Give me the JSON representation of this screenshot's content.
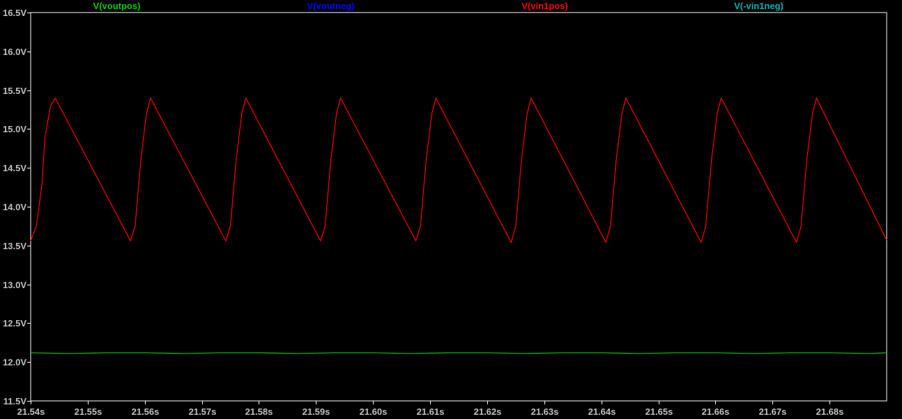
{
  "chart_data": {
    "type": "line",
    "background": "#000000",
    "axis_color": "#ffffff",
    "tick_label_color": "#c0c0c0",
    "grid": false,
    "xlim": [
      21.54,
      21.69
    ],
    "ylim": [
      11.5,
      16.5
    ],
    "x_ticks": [
      21.54,
      21.55,
      21.56,
      21.57,
      21.58,
      21.59,
      21.6,
      21.61,
      21.62,
      21.63,
      21.64,
      21.65,
      21.66,
      21.67,
      21.68
    ],
    "x_tick_labels": [
      "21.54s",
      "21.55s",
      "21.56s",
      "21.57s",
      "21.58s",
      "21.59s",
      "21.60s",
      "21.61s",
      "21.62s",
      "21.63s",
      "21.64s",
      "21.65s",
      "21.66s",
      "21.67s",
      "21.68s"
    ],
    "y_ticks": [
      11.5,
      12.0,
      12.5,
      13.0,
      13.5,
      14.0,
      14.5,
      15.0,
      15.5,
      16.0,
      16.5
    ],
    "y_tick_labels": [
      "11.5V",
      "12.0V",
      "12.5V",
      "13.0V",
      "13.5V",
      "14.0V",
      "14.5V",
      "15.0V",
      "15.5V",
      "16.0V",
      "16.5V"
    ],
    "legend_placement": "top",
    "series": [
      {
        "name": "V(voutpos)",
        "color": "#00cc00",
        "x": [
          21.54,
          21.5467,
          21.5533,
          21.56,
          21.5667,
          21.5733,
          21.58,
          21.5867,
          21.5933,
          21.6,
          21.6067,
          21.6133,
          21.62,
          21.6267,
          21.6333,
          21.64,
          21.6467,
          21.6533,
          21.66,
          21.6667,
          21.6733,
          21.68,
          21.6867,
          21.69
        ],
        "y": [
          12.12,
          12.11,
          12.12,
          12.12,
          12.11,
          12.12,
          12.12,
          12.11,
          12.12,
          12.12,
          12.11,
          12.12,
          12.12,
          12.11,
          12.12,
          12.12,
          12.11,
          12.12,
          12.12,
          12.11,
          12.12,
          12.12,
          12.11,
          12.12
        ]
      },
      {
        "name": "V(voutneg)",
        "color": "#0000ff",
        "x": [],
        "y": []
      },
      {
        "name": "V(vin1pos)",
        "color": "#ff0000",
        "x": [
          21.54,
          21.541,
          21.542,
          21.5425,
          21.5435,
          21.5443,
          21.5575,
          21.5583,
          21.5593,
          21.5603,
          21.561,
          21.5742,
          21.575,
          21.576,
          21.577,
          21.5777,
          21.5908,
          21.5916,
          21.5926,
          21.5936,
          21.5943,
          21.6075,
          21.6083,
          21.6093,
          21.6103,
          21.611,
          21.6242,
          21.625,
          21.626,
          21.627,
          21.6277,
          21.6408,
          21.6416,
          21.6426,
          21.6436,
          21.6443,
          21.6575,
          21.6583,
          21.6593,
          21.6603,
          21.661,
          21.6742,
          21.675,
          21.676,
          21.677,
          21.6777,
          21.69
        ],
        "y": [
          13.56,
          13.75,
          14.3,
          14.9,
          15.3,
          15.4,
          13.56,
          13.75,
          14.6,
          15.2,
          15.4,
          13.56,
          13.75,
          14.6,
          15.2,
          15.4,
          13.56,
          13.75,
          14.6,
          15.2,
          15.4,
          13.56,
          13.75,
          14.6,
          15.2,
          15.4,
          13.54,
          13.75,
          14.6,
          15.2,
          15.4,
          13.54,
          13.75,
          14.6,
          15.2,
          15.4,
          13.54,
          13.75,
          14.6,
          15.2,
          15.4,
          13.54,
          13.75,
          14.6,
          15.2,
          15.4,
          13.57
        ]
      },
      {
        "name": "V(-vin1neg)",
        "color": "#00b0b0",
        "x": [],
        "y": []
      }
    ]
  }
}
